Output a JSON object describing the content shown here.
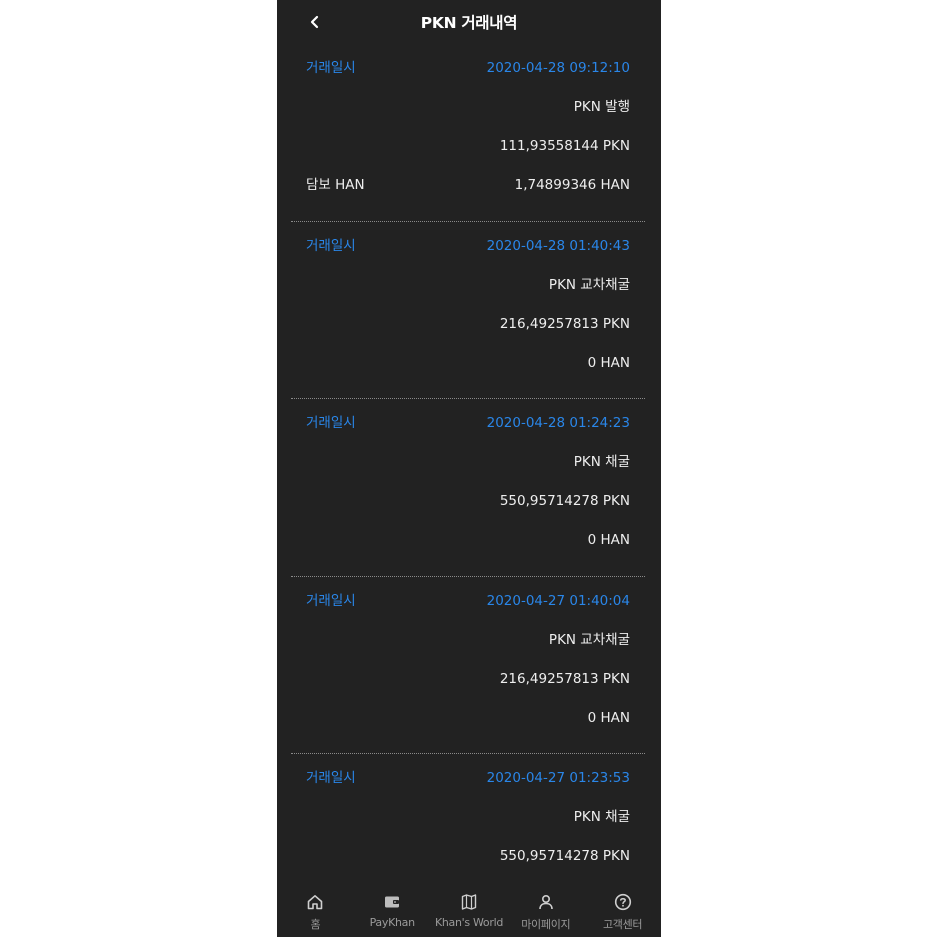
{
  "header": {
    "title": "PKN 거래내역",
    "back_icon": "chevron-left-icon"
  },
  "records": [
    {
      "date_label": "거래일시",
      "date_value": "2020-04-28 09:12:10",
      "type": "PKN 발행",
      "pkn_amount": "111,93558144 PKN",
      "han_label": "담보 HAN",
      "han_amount": "1,74899346 HAN"
    },
    {
      "date_label": "거래일시",
      "date_value": "2020-04-28 01:40:43",
      "type": "PKN 교차채굴",
      "pkn_amount": "216,49257813 PKN",
      "han_label": "",
      "han_amount": "0 HAN"
    },
    {
      "date_label": "거래일시",
      "date_value": "2020-04-28 01:24:23",
      "type": "PKN 채굴",
      "pkn_amount": "550,95714278 PKN",
      "han_label": "",
      "han_amount": "0 HAN"
    },
    {
      "date_label": "거래일시",
      "date_value": "2020-04-27 01:40:04",
      "type": "PKN 교차채굴",
      "pkn_amount": "216,49257813 PKN",
      "han_label": "",
      "han_amount": "0 HAN"
    },
    {
      "date_label": "거래일시",
      "date_value": "2020-04-27 01:23:53",
      "type": "PKN 채굴",
      "pkn_amount": "550,95714278 PKN",
      "han_label": "",
      "han_amount": ""
    }
  ],
  "tabbar": {
    "items": [
      {
        "label": "홈",
        "icon": "home-icon"
      },
      {
        "label": "PayKhan",
        "icon": "wallet-icon"
      },
      {
        "label": "Khan's World",
        "icon": "map-icon"
      },
      {
        "label": "마이페이지",
        "icon": "person-icon"
      },
      {
        "label": "고객센터",
        "icon": "help-icon"
      }
    ]
  },
  "colors": {
    "background": "#222222",
    "accent": "#2a86e8",
    "text": "#eeeeee",
    "tab_text": "#9a9a9a"
  }
}
